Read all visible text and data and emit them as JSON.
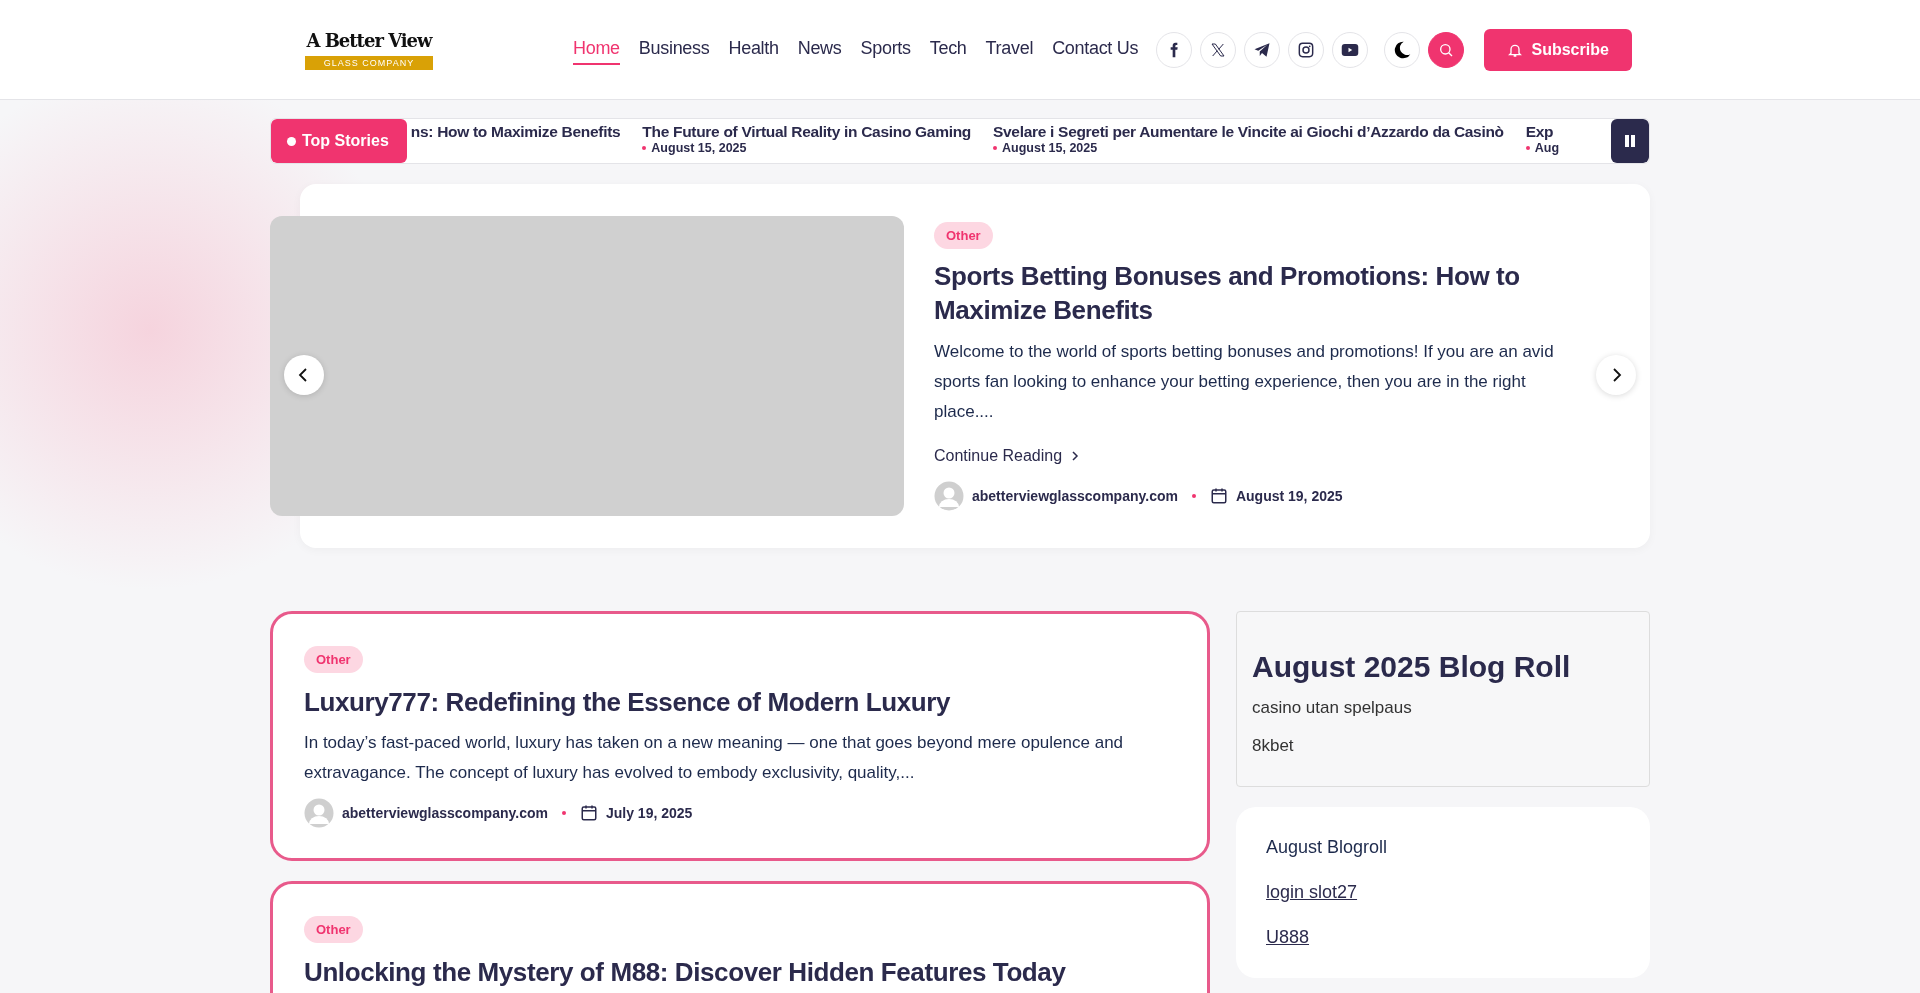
{
  "logo": {
    "title": "A Better View",
    "tagline": "GLASS COMPANY"
  },
  "nav": [
    {
      "label": "Home",
      "selected": true
    },
    {
      "label": "Business",
      "selected": false
    },
    {
      "label": "Health",
      "selected": false
    },
    {
      "label": "News",
      "selected": false
    },
    {
      "label": "Sports",
      "selected": false
    },
    {
      "label": "Tech",
      "selected": false
    },
    {
      "label": "Travel",
      "selected": false
    },
    {
      "label": "Contact Us",
      "selected": false
    }
  ],
  "social": [
    {
      "kind": "facebook"
    },
    {
      "kind": "x"
    },
    {
      "kind": "telegram"
    },
    {
      "kind": "instagram"
    },
    {
      "kind": "youtube"
    }
  ],
  "subscribe": "Subscribe",
  "ticker": {
    "label": "Top Stories",
    "items": [
      {
        "title": "ns: How to Maximize Benefits"
      },
      {
        "title": "The Future of Virtual Reality in Casino Gaming",
        "date": "August 15, 2025"
      },
      {
        "title": "Svelare i Segreti per Aumentare le Vincite ai Giochi d’Azzardo da Casinò",
        "date": "August 15, 2025"
      },
      {
        "title": "Exp",
        "date": "Aug"
      }
    ]
  },
  "hero": {
    "category": "Other",
    "title": "Sports Betting Bonuses and Promotions: How to Maximize Benefits",
    "excerpt": "Welcome to the world of sports betting bonuses and promotions! If you are an avid sports fan looking to enhance your betting experience, then you are in the right place....",
    "read_more": "Continue Reading",
    "author": "abetterviewglasscompany.com",
    "date": "August 19, 2025"
  },
  "posts": [
    {
      "category": "Other",
      "title": "Luxury777: Redefining the Essence of Modern Luxury",
      "excerpt": "In today’s fast-paced world, luxury has taken on a new meaning — one that goes beyond mere opulence and extravagance. The concept of luxury has evolved to embody exclusivity, quality,...",
      "author": "abetterviewglasscompany.com",
      "date": "July 19, 2025"
    },
    {
      "category": "Other",
      "title": "Unlocking the Mystery of M88: Discover Hidden Features Today"
    }
  ],
  "sidebar": {
    "blog_roll": {
      "title": "August 2025 Blog Roll",
      "items": [
        "casino utan spelpaus",
        "8kbet"
      ]
    },
    "links": [
      {
        "label": "August Blogroll",
        "kind": "text"
      },
      {
        "label": "login slot27",
        "kind": "link"
      },
      {
        "label": "U888",
        "kind": "link"
      }
    ]
  }
}
